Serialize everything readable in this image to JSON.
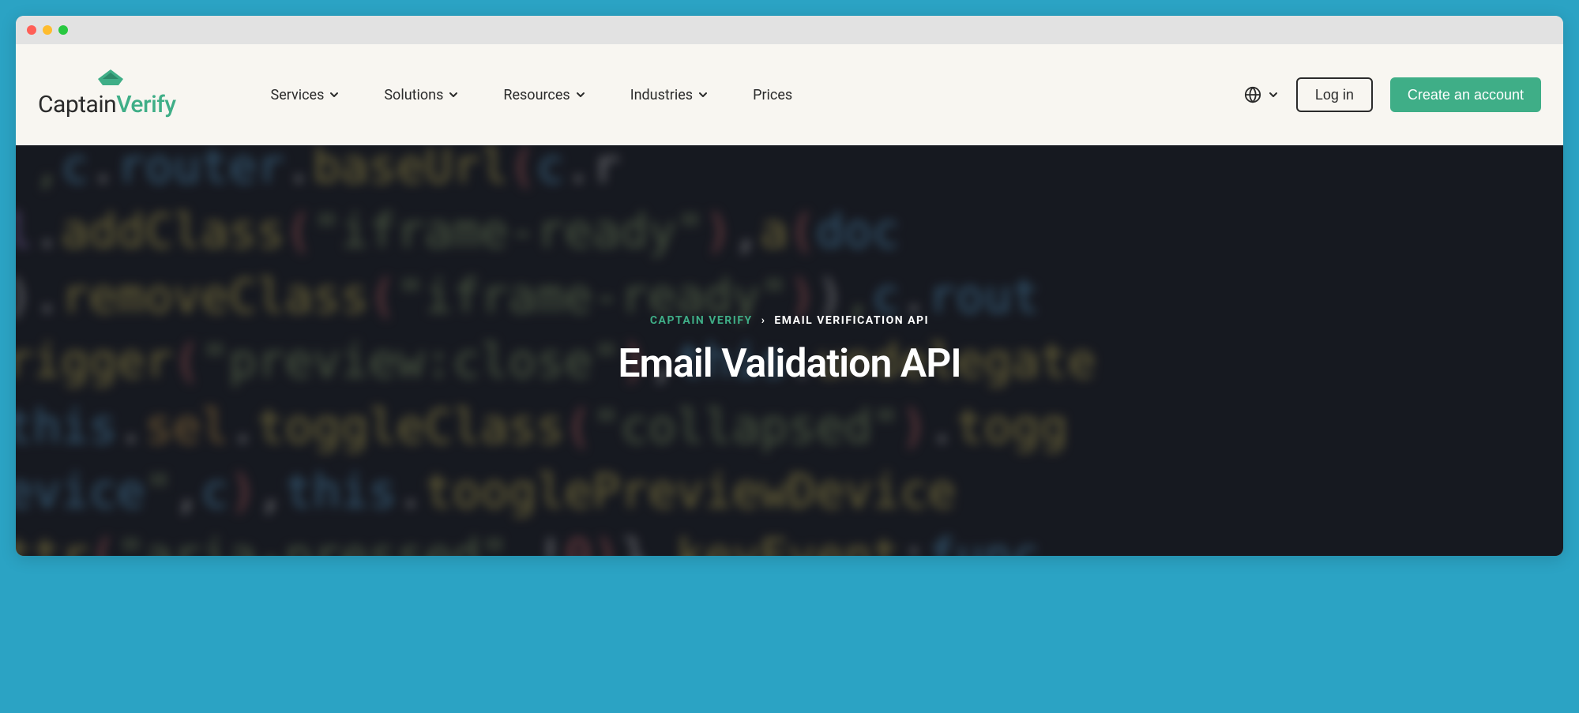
{
  "logo": {
    "captain": "Captain",
    "verify": "Verify"
  },
  "nav": {
    "items": [
      {
        "label": "Services",
        "has_dropdown": true
      },
      {
        "label": "Solutions",
        "has_dropdown": true
      },
      {
        "label": "Resources",
        "has_dropdown": true
      },
      {
        "label": "Industries",
        "has_dropdown": true
      },
      {
        "label": "Prices",
        "has_dropdown": false
      }
    ]
  },
  "actions": {
    "login_label": "Log in",
    "create_label": "Create an account"
  },
  "breadcrumb": {
    "root": "CAPTAIN VERIFY",
    "separator": "›",
    "current": "EMAIL VERIFICATION API"
  },
  "hero": {
    "title": "Email Validation API"
  },
  "colors": {
    "accent": "#3fae87",
    "frame": "#2ba3c4",
    "header_bg": "#f8f6f1"
  }
}
